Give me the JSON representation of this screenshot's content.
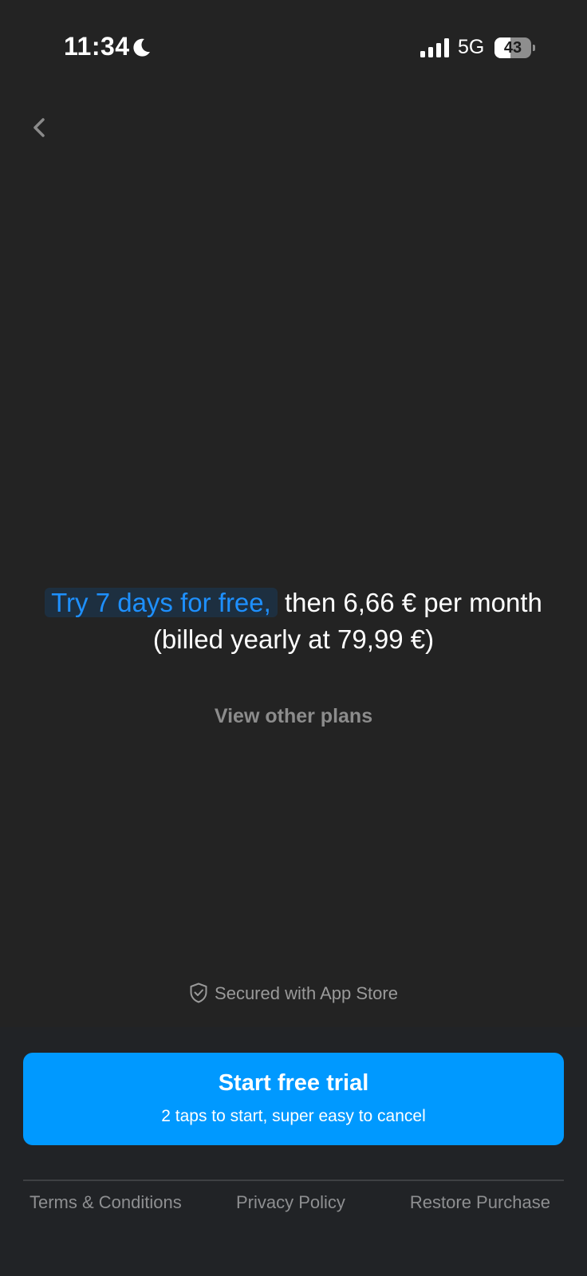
{
  "status_bar": {
    "time": "11:34",
    "network": "5G",
    "battery_level": "43",
    "battery_fraction": 0.43,
    "icons": [
      "moon-icon",
      "signal-icon",
      "battery-icon"
    ]
  },
  "nav": {
    "back_icon": "chevron-left-icon"
  },
  "offer": {
    "highlight": "Try 7 days for free,",
    "rest": " then 6,66 € per month (billed yearly at 79,99 €)"
  },
  "view_plans_label": "View other plans",
  "secured": {
    "icon": "shield-check-icon",
    "label": "Secured with App Store"
  },
  "cta": {
    "title": "Start free trial",
    "subtitle": "2 taps to start, super easy to cancel"
  },
  "footer": {
    "terms": "Terms & Conditions",
    "privacy": "Privacy Policy",
    "restore": "Restore Purchase"
  },
  "colors": {
    "background": "#232323",
    "accent": "#0099ff",
    "highlight_text": "#1e90ff",
    "muted_text": "#8c8c8c"
  }
}
